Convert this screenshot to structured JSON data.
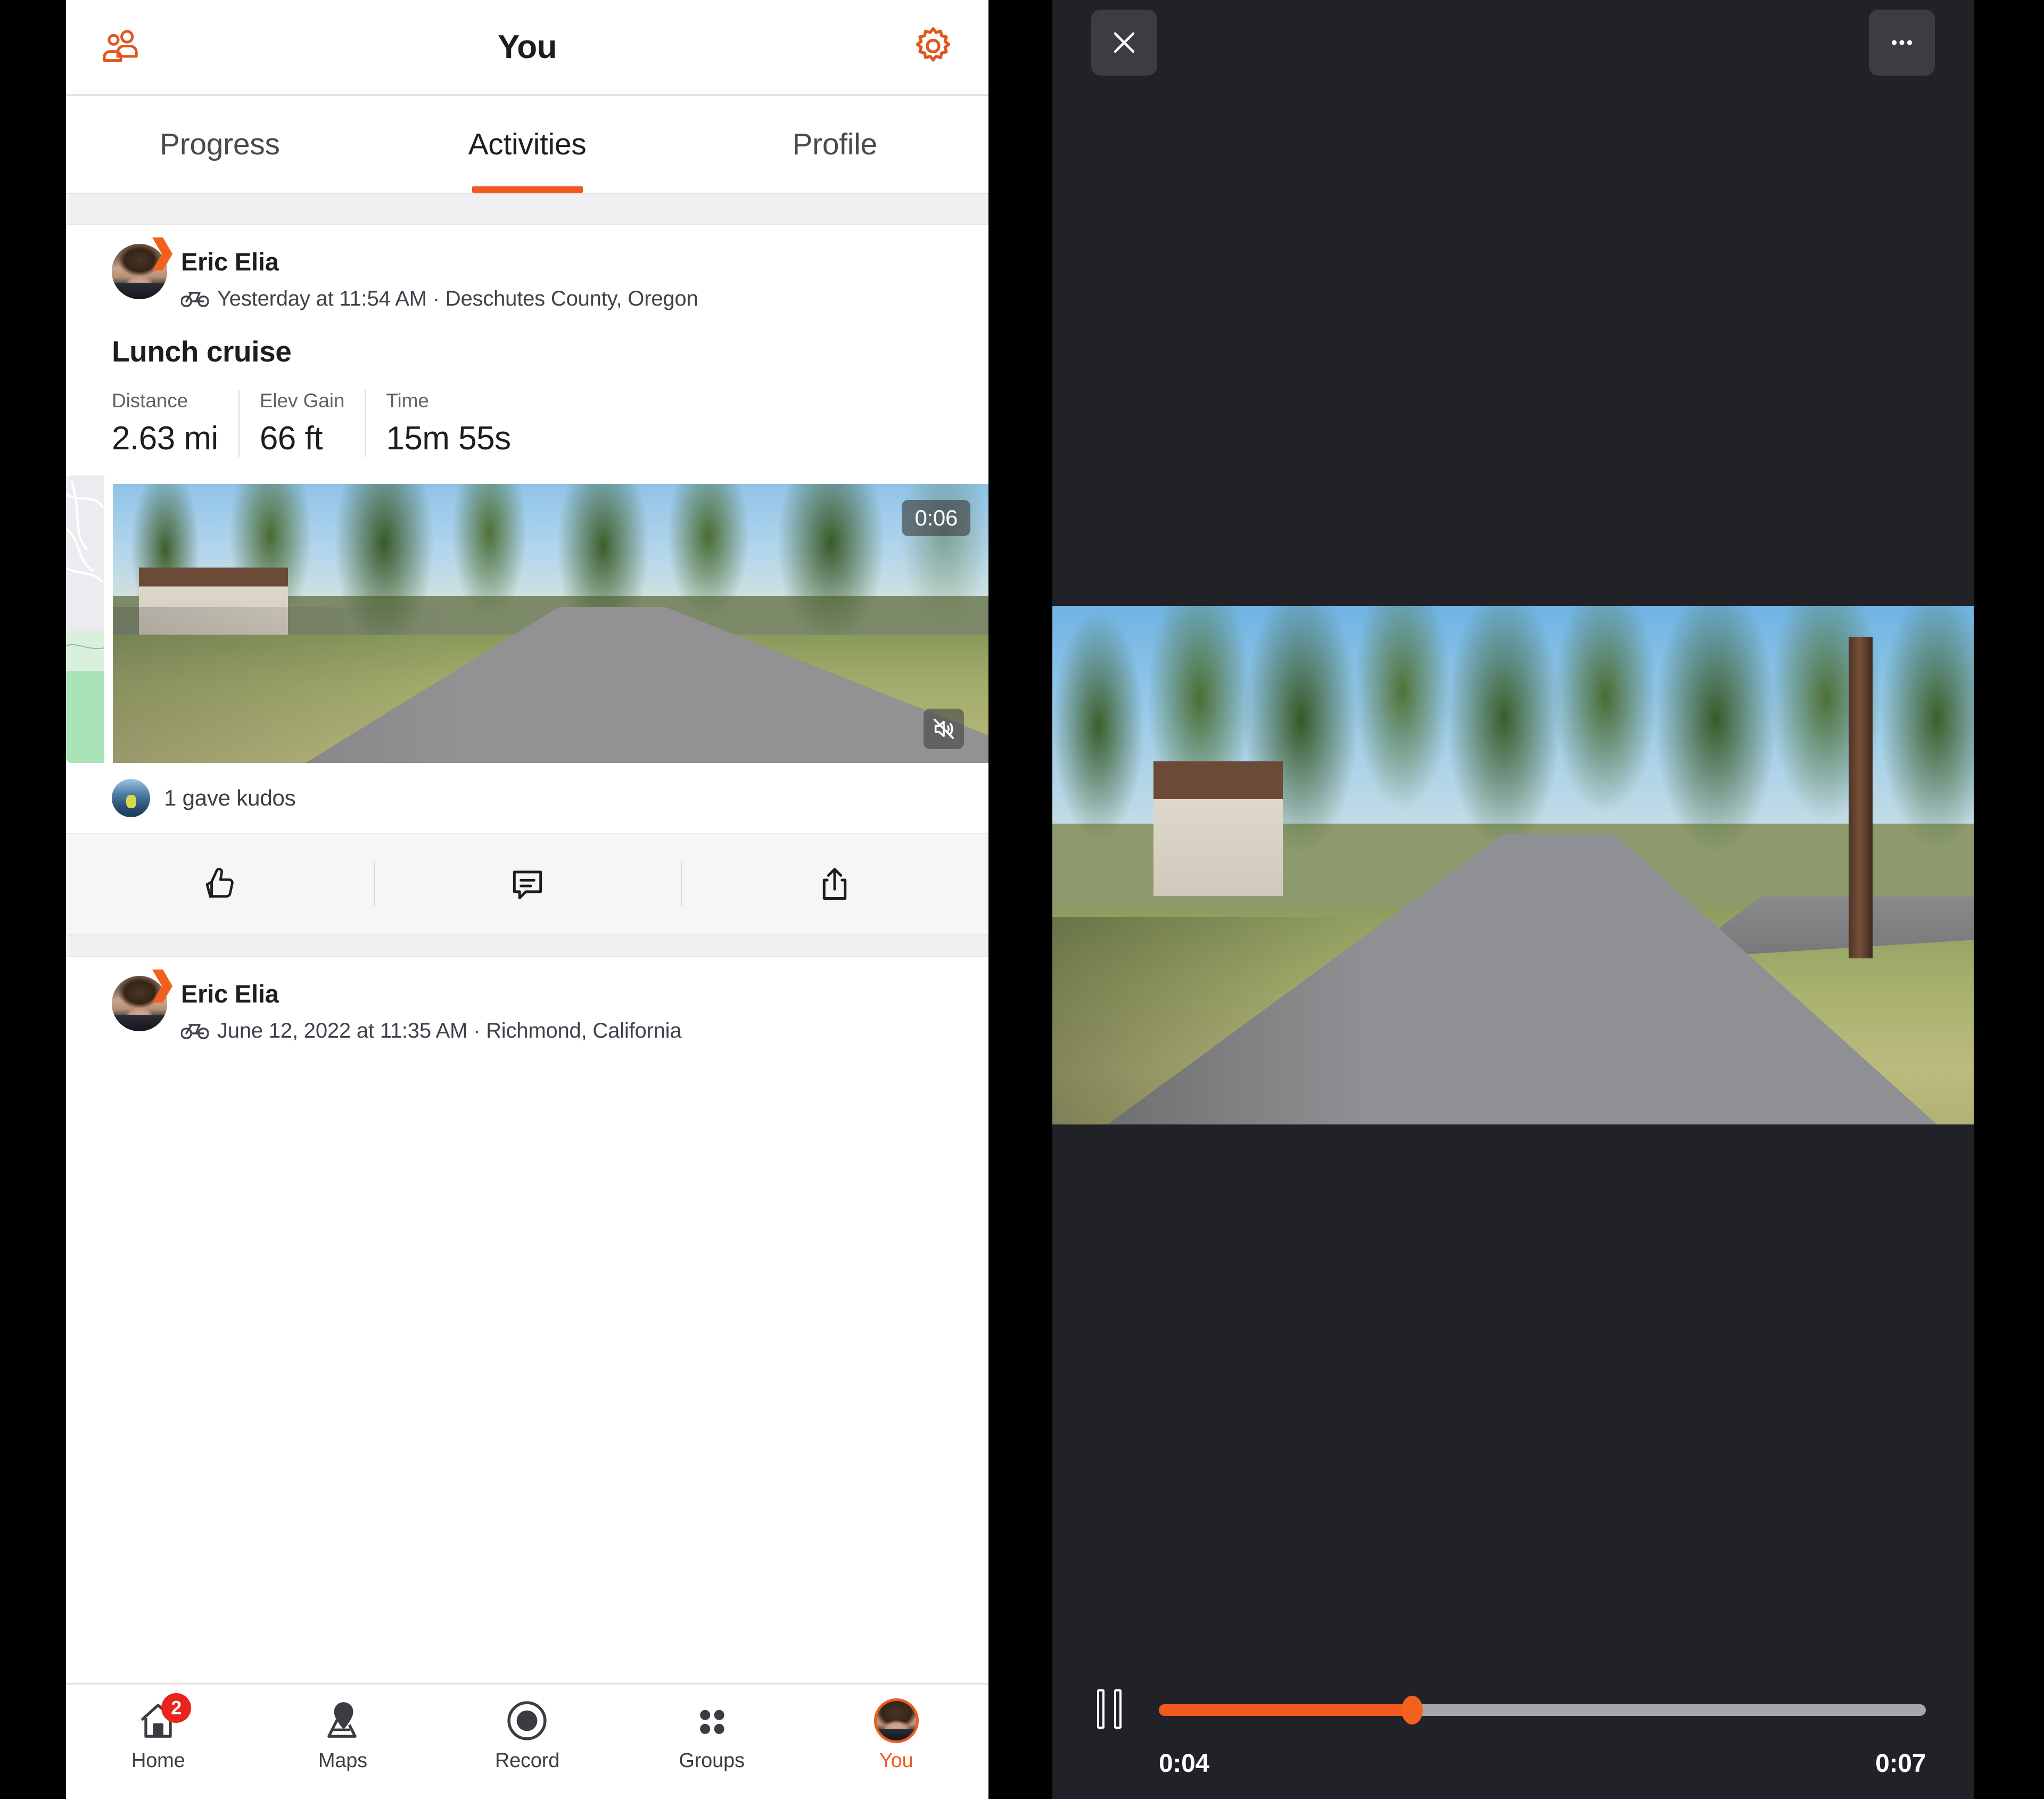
{
  "app": {
    "header": {
      "title": "You",
      "left_icon": "group-people-icon",
      "right_icon": "gear-icon"
    },
    "tabs": [
      {
        "label": "Progress",
        "active": false
      },
      {
        "label": "Activities",
        "active": true
      },
      {
        "label": "Profile",
        "active": false
      }
    ],
    "activity": {
      "user_name": "Eric Elia",
      "sport_icon": "bicycle-icon",
      "meta": "Yesterday at 11:54 AM · Deschutes County, Oregon",
      "title": "Lunch cruise",
      "stats": [
        {
          "label": "Distance",
          "value": "2.63 mi"
        },
        {
          "label": "Elev Gain",
          "value": "66 ft"
        },
        {
          "label": "Time",
          "value": "15m 55s"
        }
      ],
      "media": {
        "duration_badge": "0:06",
        "mute_icon": "speaker-muted-icon"
      },
      "kudos_text": "1 gave kudos",
      "actions": [
        {
          "name": "kudos",
          "icon": "thumbs-up-icon"
        },
        {
          "name": "comment",
          "icon": "comment-bubble-icon"
        },
        {
          "name": "share",
          "icon": "share-arrow-icon"
        }
      ]
    },
    "activity2": {
      "user_name": "Eric Elia",
      "sport_icon": "bicycle-icon",
      "meta": "June 12, 2022 at 11:35 AM · Richmond, California"
    },
    "tabbar": [
      {
        "label": "Home",
        "icon": "house-icon",
        "badge": "2",
        "active": false
      },
      {
        "label": "Maps",
        "icon": "map-pin-icon",
        "badge": "",
        "active": false
      },
      {
        "label": "Record",
        "icon": "record-circle-icon",
        "badge": "",
        "active": false
      },
      {
        "label": "Groups",
        "icon": "groups-dots-icon",
        "badge": "",
        "active": false
      },
      {
        "label": "You",
        "icon": "user-avatar-icon",
        "badge": "",
        "active": true
      }
    ]
  },
  "player": {
    "close_icon": "close-x-icon",
    "more_icon": "more-dots-icon",
    "pause_icon": "pause-icon",
    "current_time": "0:04",
    "total_time": "0:07",
    "progress_percent": 33
  },
  "colors": {
    "accent_orange": "#ee5a1f",
    "badge_red": "#e8241b",
    "player_bg": "#212227",
    "track_gray": "#a7a7ab",
    "text_primary": "#1c1d1f",
    "text_secondary": "#60626b"
  }
}
